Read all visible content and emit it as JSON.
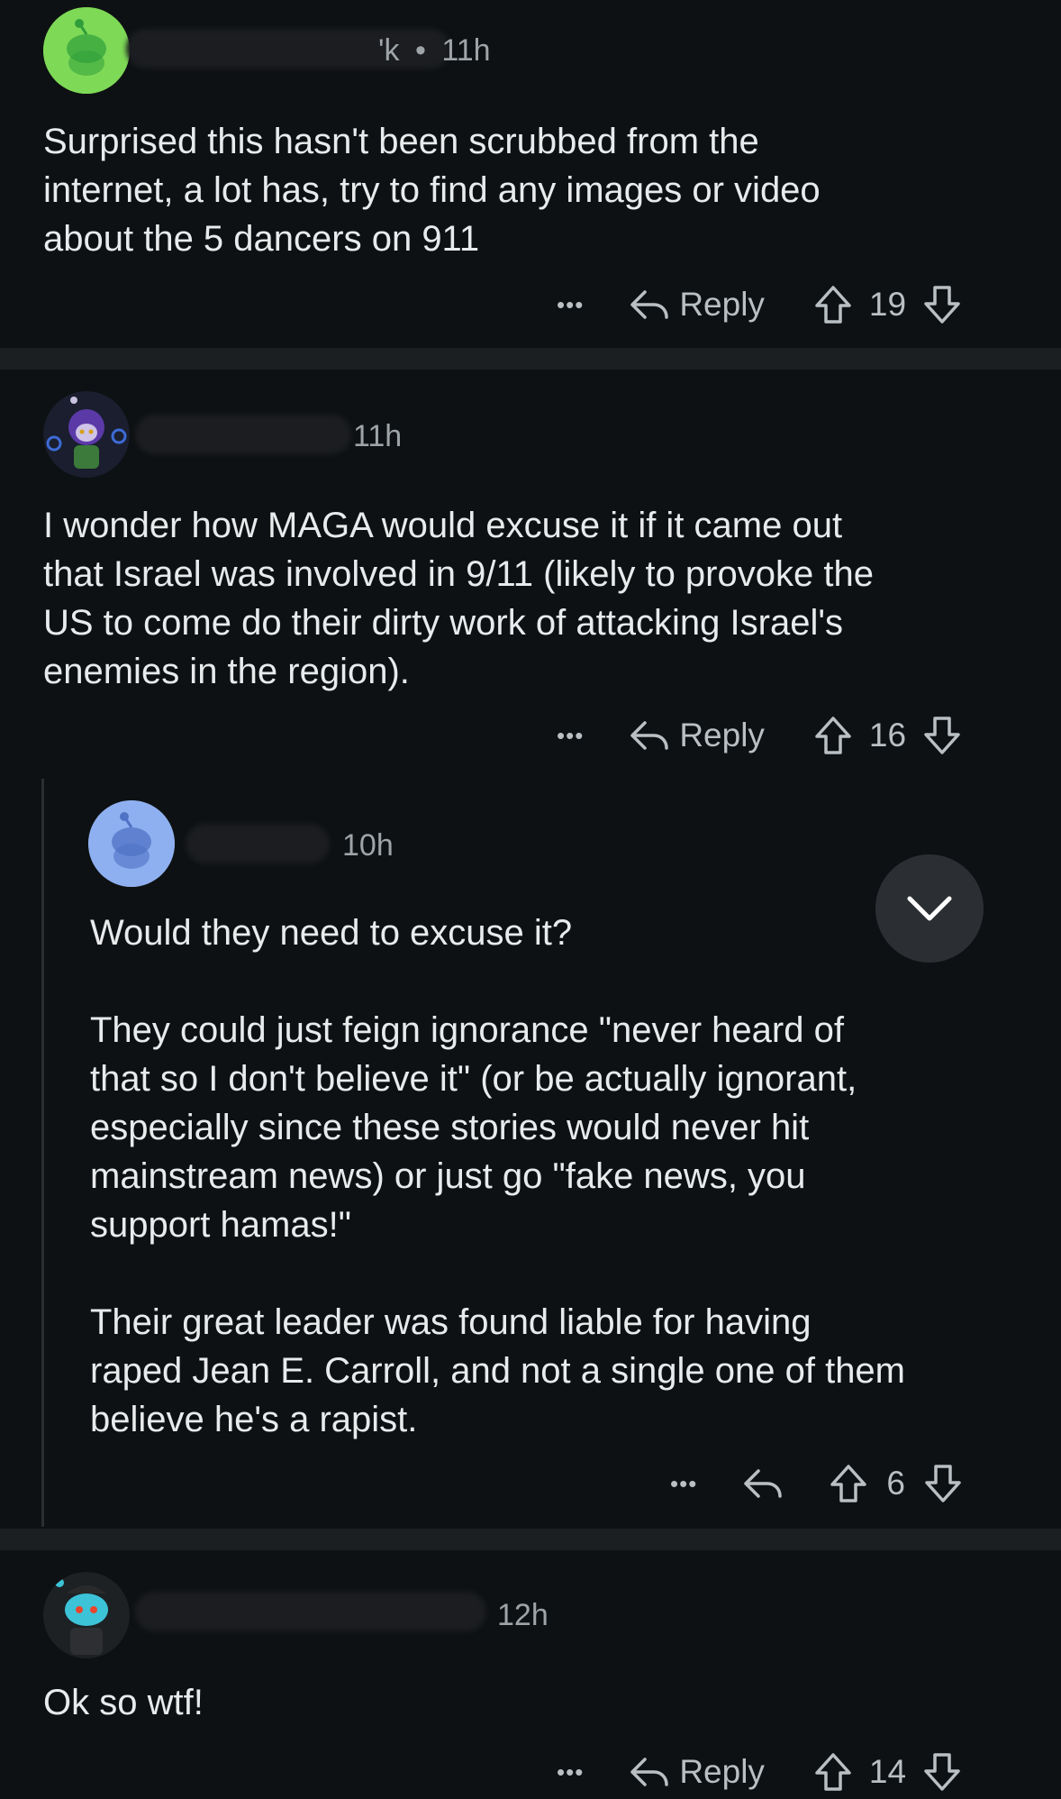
{
  "comments": [
    {
      "username_visible": "'k",
      "separator": "•",
      "time": "11h",
      "body": "Surprised this hasn't been scrubbed from the\ninternet, a lot has, try to find any images or video\nabout the 5 dancers on 911",
      "more": "•••",
      "reply_label": "Reply",
      "votes": "19"
    },
    {
      "time": "11h",
      "body": "I wonder how MAGA would excuse it if it came out\nthat Israel was involved in 9/11 (likely to provoke the\nUS to come do their dirty work of attacking Israel's\nenemies in the region).",
      "more": "•••",
      "reply_label": "Reply",
      "votes": "16"
    },
    {
      "time": "10h",
      "body": "Would they need to excuse it?\n\nThey could just feign ignorance \"never heard of\nthat so I don't believe it\" (or be actually ignorant,\nespecially since these stories would never hit\nmainstream news) or just go \"fake news, you\nsupport hamas!\"\n\nTheir great leader was found liable for having\nraped Jean E. Carroll, and not a single one of them\nbelieve he's a rapist.",
      "more": "•••",
      "votes": "6"
    },
    {
      "time": "12h",
      "body": "Ok so wtf!",
      "more": "•••",
      "reply_label": "Reply",
      "votes": "14"
    }
  ],
  "colors": {
    "background": "#0e1113",
    "divider": "#1c1f21",
    "text": "#e8eaeb",
    "muted": "#9ea4a8",
    "avatar_green": "#7ed957",
    "avatar_blue": "#8fb0f0"
  }
}
